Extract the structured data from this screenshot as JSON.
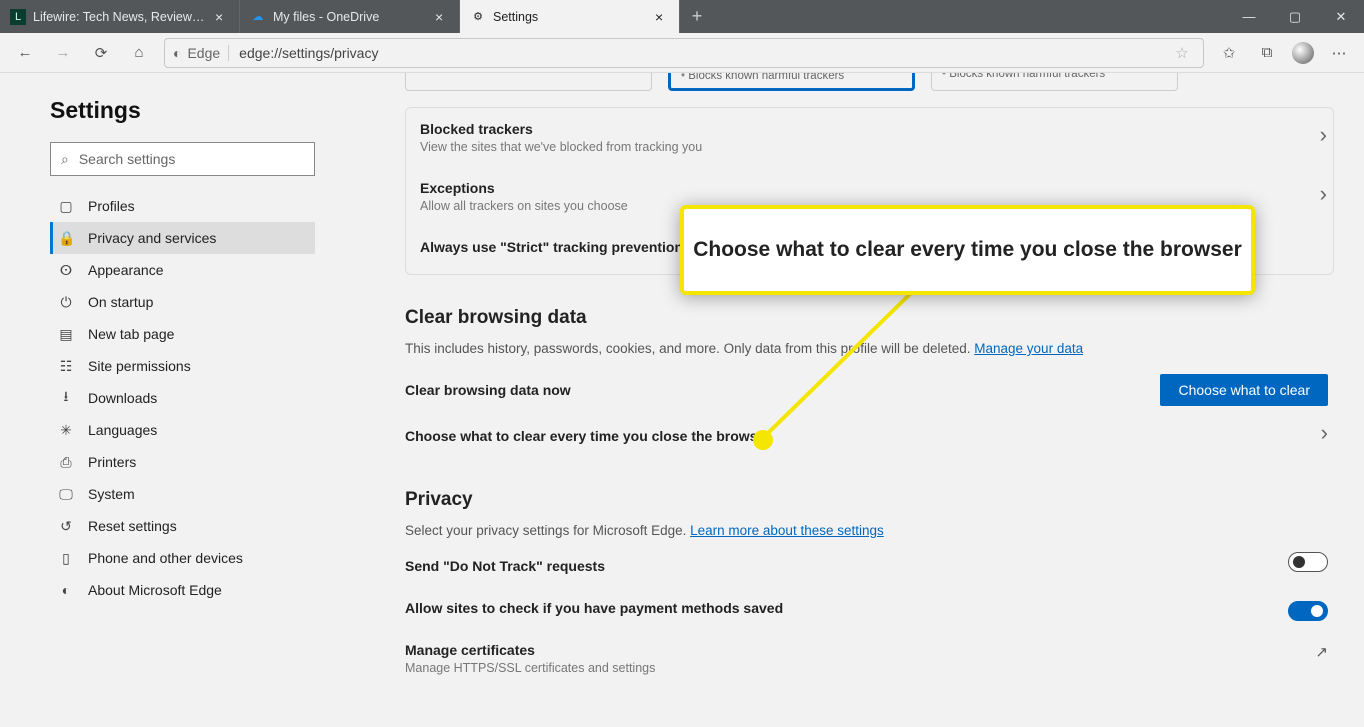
{
  "tabs": [
    {
      "title": "Lifewire: Tech News, Reviews, He"
    },
    {
      "title": "My files - OneDrive"
    },
    {
      "title": "Settings"
    }
  ],
  "toolbar": {
    "edge_label": "Edge",
    "url": "edge://settings/privacy"
  },
  "sidebar": {
    "heading": "Settings",
    "search_placeholder": "Search settings",
    "items": [
      "Profiles",
      "Privacy and services",
      "Appearance",
      "On startup",
      "New tab page",
      "Site permissions",
      "Downloads",
      "Languages",
      "Printers",
      "System",
      "Reset settings",
      "Phone and other devices",
      "About Microsoft Edge"
    ]
  },
  "tracking": {
    "card_bullet": "Blocks known harmful trackers",
    "card_bullet2": "Blocks known harmful trackers",
    "blocked_title": "Blocked trackers",
    "blocked_sub": "View the sites that we've blocked from tracking you",
    "exceptions_title": "Exceptions",
    "exceptions_sub": "Allow all trackers on sites you choose",
    "strict_title": "Always use \"Strict\" tracking prevention whe"
  },
  "clear": {
    "heading": "Clear browsing data",
    "desc_a": "This includes history, passwords, cookies, and more. Only data from this profile will be deleted. ",
    "manage_link": "Manage your data",
    "now_title": "Clear browsing data now",
    "now_button": "Choose what to clear",
    "everytime_title": "Choose what to clear every time you close the browser"
  },
  "privacy": {
    "heading": "Privacy",
    "desc_a": "Select your privacy settings for Microsoft Edge. ",
    "learn_link": "Learn more about these settings",
    "dnt_title": "Send \"Do Not Track\" requests",
    "payment_title": "Allow sites to check if you have payment methods saved",
    "certs_title": "Manage certificates",
    "certs_sub": "Manage HTTPS/SSL certificates and settings"
  },
  "callout": {
    "text": "Choose what to clear every time you close the browser"
  }
}
